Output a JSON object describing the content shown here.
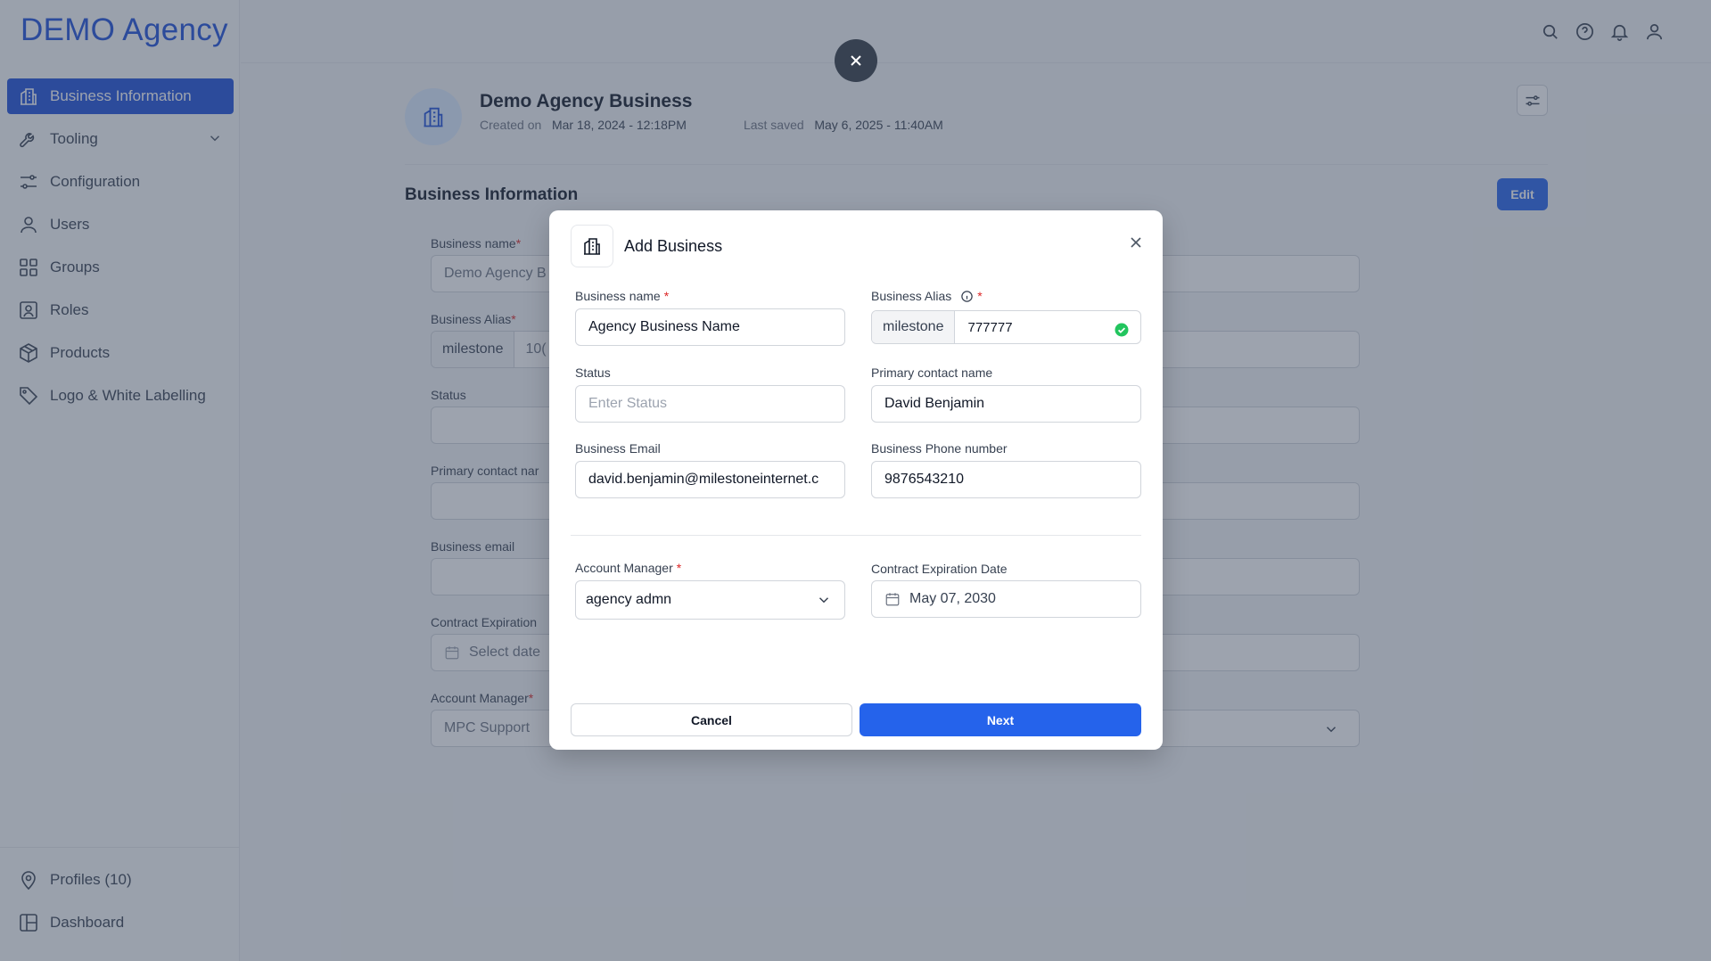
{
  "app": {
    "brand": "DEMO Agency"
  },
  "sidebar": {
    "items": [
      {
        "label": "Business Information",
        "icon": "building-icon"
      },
      {
        "label": "Tooling",
        "icon": "wrench-icon"
      },
      {
        "label": "Configuration",
        "icon": "sliders-icon"
      },
      {
        "label": "Users",
        "icon": "user-icon"
      },
      {
        "label": "Groups",
        "icon": "grid-icon"
      },
      {
        "label": "Roles",
        "icon": "id-card-icon"
      },
      {
        "label": "Products",
        "icon": "box-icon"
      },
      {
        "label": "Logo & White Labelling",
        "icon": "tag-icon"
      }
    ],
    "bottom": [
      {
        "label": "Profiles (10)",
        "icon": "map-pin-icon"
      },
      {
        "label": "Dashboard",
        "icon": "layout-icon"
      }
    ]
  },
  "header": {
    "business_title": "Demo Agency Business",
    "created_label": "Created on",
    "created_value": "Mar 18, 2024 - 12:18PM",
    "saved_label": "Last saved",
    "saved_value": "May 6, 2025 - 11:40AM"
  },
  "section": {
    "title": "Business Information",
    "edit_label": "Edit",
    "fields": [
      {
        "label": "Business name",
        "required": "*",
        "value": "Demo Agency B"
      },
      {
        "label": "Business Alias",
        "required": "*",
        "prefix": "milestone",
        "value": "10("
      },
      {
        "label": "Status",
        "required": "",
        "value": ""
      },
      {
        "label": "Primary contact nar",
        "required": "",
        "value": ""
      },
      {
        "label": "Business email",
        "required": "",
        "value": ""
      },
      {
        "label": "Contract Expiration",
        "required": "",
        "value": "Select date"
      },
      {
        "label": "Account Manager",
        "required": "*",
        "value": "MPC Support"
      }
    ]
  },
  "modal": {
    "title": "Add Business",
    "business_name": {
      "label": "Business name",
      "required": "*",
      "value": "Agency Business Name"
    },
    "business_alias": {
      "label": "Business Alias",
      "required": "*",
      "prefix": "milestone",
      "value": "777777"
    },
    "status": {
      "label": "Status",
      "placeholder": "Enter Status"
    },
    "primary_contact": {
      "label": "Primary contact name",
      "value": "David Benjamin"
    },
    "business_email": {
      "label": "Business Email",
      "value": "david.benjamin@milestoneinternet.c"
    },
    "business_phone": {
      "label": "Business Phone number",
      "value": "9876543210"
    },
    "account_manager": {
      "label": "Account Manager",
      "required": "*",
      "value": "agency admn"
    },
    "contract_expiration": {
      "label": "Contract Expiration Date",
      "value": "May 07, 2030"
    },
    "cancel_label": "Cancel",
    "next_label": "Next"
  },
  "colors": {
    "primary": "#2563eb",
    "required": "#dc2626",
    "success": "#22c55e"
  }
}
